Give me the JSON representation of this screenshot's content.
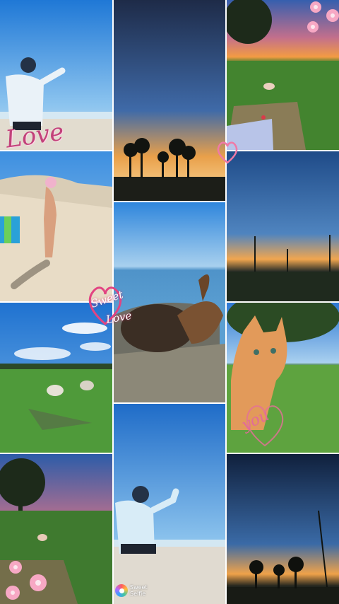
{
  "collage": {
    "tiles": [
      {
        "id": "beach-man-waving",
        "description_icon": "photo"
      },
      {
        "id": "sunset-palms",
        "description_icon": "photo"
      },
      {
        "id": "park-sunset-shoes",
        "description_icon": "photo"
      }
    ]
  },
  "stickers": {
    "love": "Love",
    "sweet_line1": "Sweet",
    "sweet_line2": "Love",
    "you": "you"
  },
  "watermark": {
    "line1": "Sweet",
    "line2": "Selfie"
  },
  "colors": {
    "sky_blue": "#2f8fe0",
    "sunset_orange": "#f2a23a",
    "grass_green": "#4f9a3a",
    "sticker_pink": "#e26a9a"
  }
}
